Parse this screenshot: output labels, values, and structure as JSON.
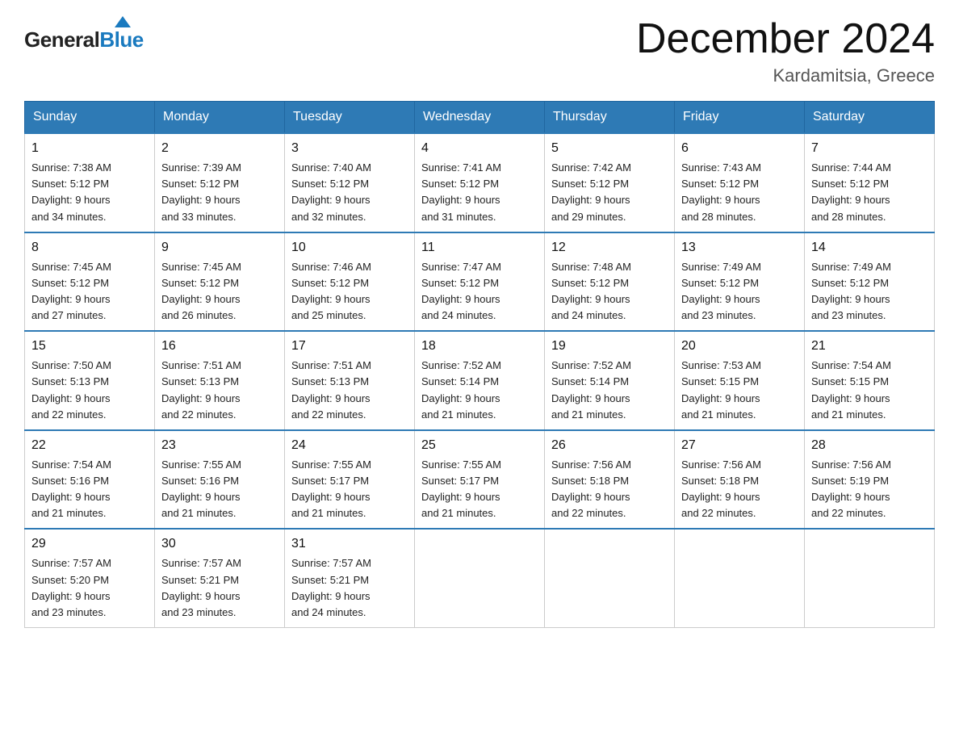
{
  "logo": {
    "general": "General",
    "blue": "Blue",
    "tagline": ""
  },
  "header": {
    "title": "December 2024",
    "subtitle": "Kardamitsia, Greece"
  },
  "columns": [
    "Sunday",
    "Monday",
    "Tuesday",
    "Wednesday",
    "Thursday",
    "Friday",
    "Saturday"
  ],
  "weeks": [
    [
      {
        "day": "1",
        "sunrise": "7:38 AM",
        "sunset": "5:12 PM",
        "daylight": "9 hours and 34 minutes."
      },
      {
        "day": "2",
        "sunrise": "7:39 AM",
        "sunset": "5:12 PM",
        "daylight": "9 hours and 33 minutes."
      },
      {
        "day": "3",
        "sunrise": "7:40 AM",
        "sunset": "5:12 PM",
        "daylight": "9 hours and 32 minutes."
      },
      {
        "day": "4",
        "sunrise": "7:41 AM",
        "sunset": "5:12 PM",
        "daylight": "9 hours and 31 minutes."
      },
      {
        "day": "5",
        "sunrise": "7:42 AM",
        "sunset": "5:12 PM",
        "daylight": "9 hours and 29 minutes."
      },
      {
        "day": "6",
        "sunrise": "7:43 AM",
        "sunset": "5:12 PM",
        "daylight": "9 hours and 28 minutes."
      },
      {
        "day": "7",
        "sunrise": "7:44 AM",
        "sunset": "5:12 PM",
        "daylight": "9 hours and 28 minutes."
      }
    ],
    [
      {
        "day": "8",
        "sunrise": "7:45 AM",
        "sunset": "5:12 PM",
        "daylight": "9 hours and 27 minutes."
      },
      {
        "day": "9",
        "sunrise": "7:45 AM",
        "sunset": "5:12 PM",
        "daylight": "9 hours and 26 minutes."
      },
      {
        "day": "10",
        "sunrise": "7:46 AM",
        "sunset": "5:12 PM",
        "daylight": "9 hours and 25 minutes."
      },
      {
        "day": "11",
        "sunrise": "7:47 AM",
        "sunset": "5:12 PM",
        "daylight": "9 hours and 24 minutes."
      },
      {
        "day": "12",
        "sunrise": "7:48 AM",
        "sunset": "5:12 PM",
        "daylight": "9 hours and 24 minutes."
      },
      {
        "day": "13",
        "sunrise": "7:49 AM",
        "sunset": "5:12 PM",
        "daylight": "9 hours and 23 minutes."
      },
      {
        "day": "14",
        "sunrise": "7:49 AM",
        "sunset": "5:12 PM",
        "daylight": "9 hours and 23 minutes."
      }
    ],
    [
      {
        "day": "15",
        "sunrise": "7:50 AM",
        "sunset": "5:13 PM",
        "daylight": "9 hours and 22 minutes."
      },
      {
        "day": "16",
        "sunrise": "7:51 AM",
        "sunset": "5:13 PM",
        "daylight": "9 hours and 22 minutes."
      },
      {
        "day": "17",
        "sunrise": "7:51 AM",
        "sunset": "5:13 PM",
        "daylight": "9 hours and 22 minutes."
      },
      {
        "day": "18",
        "sunrise": "7:52 AM",
        "sunset": "5:14 PM",
        "daylight": "9 hours and 21 minutes."
      },
      {
        "day": "19",
        "sunrise": "7:52 AM",
        "sunset": "5:14 PM",
        "daylight": "9 hours and 21 minutes."
      },
      {
        "day": "20",
        "sunrise": "7:53 AM",
        "sunset": "5:15 PM",
        "daylight": "9 hours and 21 minutes."
      },
      {
        "day": "21",
        "sunrise": "7:54 AM",
        "sunset": "5:15 PM",
        "daylight": "9 hours and 21 minutes."
      }
    ],
    [
      {
        "day": "22",
        "sunrise": "7:54 AM",
        "sunset": "5:16 PM",
        "daylight": "9 hours and 21 minutes."
      },
      {
        "day": "23",
        "sunrise": "7:55 AM",
        "sunset": "5:16 PM",
        "daylight": "9 hours and 21 minutes."
      },
      {
        "day": "24",
        "sunrise": "7:55 AM",
        "sunset": "5:17 PM",
        "daylight": "9 hours and 21 minutes."
      },
      {
        "day": "25",
        "sunrise": "7:55 AM",
        "sunset": "5:17 PM",
        "daylight": "9 hours and 21 minutes."
      },
      {
        "day": "26",
        "sunrise": "7:56 AM",
        "sunset": "5:18 PM",
        "daylight": "9 hours and 22 minutes."
      },
      {
        "day": "27",
        "sunrise": "7:56 AM",
        "sunset": "5:18 PM",
        "daylight": "9 hours and 22 minutes."
      },
      {
        "day": "28",
        "sunrise": "7:56 AM",
        "sunset": "5:19 PM",
        "daylight": "9 hours and 22 minutes."
      }
    ],
    [
      {
        "day": "29",
        "sunrise": "7:57 AM",
        "sunset": "5:20 PM",
        "daylight": "9 hours and 23 minutes."
      },
      {
        "day": "30",
        "sunrise": "7:57 AM",
        "sunset": "5:21 PM",
        "daylight": "9 hours and 23 minutes."
      },
      {
        "day": "31",
        "sunrise": "7:57 AM",
        "sunset": "5:21 PM",
        "daylight": "9 hours and 24 minutes."
      },
      null,
      null,
      null,
      null
    ]
  ],
  "labels": {
    "sunrise": "Sunrise:",
    "sunset": "Sunset:",
    "daylight": "Daylight:"
  }
}
